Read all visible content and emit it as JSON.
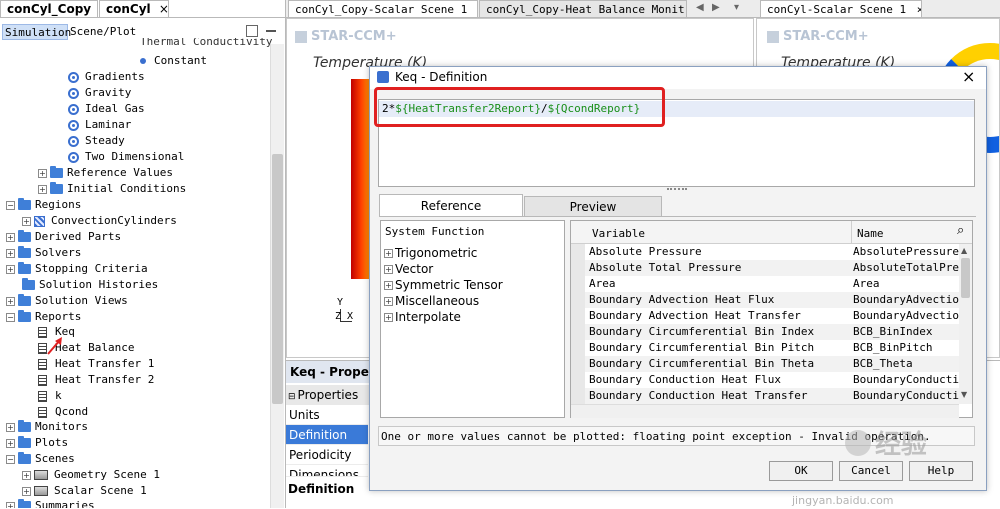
{
  "left_tabs": [
    {
      "label": "conCyl_Copy"
    },
    {
      "label": "conCyl",
      "close": "×"
    }
  ],
  "left_subtabs": [
    {
      "label": "Simulation"
    },
    {
      "label": "Scene/Plot"
    }
  ],
  "scene_tabs": [
    {
      "label": "conCyl_Copy-Scalar Scene 1",
      "close": "×"
    },
    {
      "label": "conCyl_Copy-Heat Balance Monit"
    },
    {
      "label": "conCyl-Scalar Scene 1",
      "close": "×"
    }
  ],
  "tree": {
    "partial_top": "Thermal Conductivity",
    "constant": "Constant",
    "models": [
      "Gradients",
      "Gravity",
      "Ideal Gas",
      "Laminar",
      "Steady",
      "Two Dimensional"
    ],
    "reference_values": "Reference Values",
    "initial_conditions": "Initial Conditions",
    "regions": "Regions",
    "region_child": "ConvectionCylinders",
    "derived_parts": "Derived Parts",
    "solvers": "Solvers",
    "stopping_criteria": "Stopping Criteria",
    "solution_histories": "Solution Histories",
    "solution_views": "Solution Views",
    "reports": "Reports",
    "report_items": [
      "Keq",
      "Heat Balance",
      "Heat Transfer 1",
      "Heat Transfer 2",
      "k",
      "Qcond"
    ],
    "monitors": "Monitors",
    "plots": "Plots",
    "scenes": "Scenes",
    "scene_items": [
      "Geometry Scene 1",
      "Scalar Scene 1"
    ],
    "summaries": "Summaries"
  },
  "scene_left": {
    "logo": "STAR-CCM+",
    "title": "Temperature (K)",
    "axis_y": "Y",
    "axis_z": "Z",
    "axis_x": "X"
  },
  "scene_right": {
    "logo": "STAR-CCM+",
    "title": "Temperature (K)"
  },
  "properties": {
    "header": "Keq - Properties",
    "section": "Properties",
    "rows": [
      "Units",
      "Definition",
      "Periodicity",
      "Dimensions"
    ],
    "footer_label": "Definition"
  },
  "dialog": {
    "title": "Keq - Definition",
    "close": "×",
    "expr_prefix": "2*",
    "expr_var1": "${HeatTransfer2Report}",
    "expr_slash": "/",
    "expr_var2": "${QcondReport}",
    "tabs": [
      "Reference",
      "Preview"
    ],
    "sf_header": "System Function",
    "sf_items": [
      "Trigonometric",
      "Vector",
      "Symmetric Tensor",
      "Miscellaneous",
      "Interpolate"
    ],
    "col_variable": "Variable",
    "col_name": "Name",
    "variables": [
      {
        "variable": "Absolute Pressure",
        "name": "AbsolutePressure"
      },
      {
        "variable": "Absolute Total Pressure",
        "name": "AbsoluteTotalPres"
      },
      {
        "variable": "Area",
        "name": "Area"
      },
      {
        "variable": "Boundary Advection Heat Flux",
        "name": "BoundaryAdvection"
      },
      {
        "variable": "Boundary Advection Heat Transfer",
        "name": "BoundaryAdvection"
      },
      {
        "variable": "Boundary Circumferential Bin Index",
        "name": "BCB_BinIndex"
      },
      {
        "variable": "Boundary Circumferential Bin Pitch",
        "name": "BCB_BinPitch"
      },
      {
        "variable": "Boundary Circumferential Bin Theta",
        "name": "BCB_Theta"
      },
      {
        "variable": "Boundary Conduction Heat Flux",
        "name": "BoundaryConductic"
      },
      {
        "variable": "Boundary Conduction Heat Transfer",
        "name": "BoundaryConductic"
      }
    ],
    "status": "One or more values cannot be plotted: floating point exception - Invalid operation.",
    "buttons": [
      "OK",
      "Cancel",
      "Help"
    ]
  },
  "watermark": {
    "text": "经验",
    "url": "jingyan.baidu.com"
  },
  "colors": {
    "accent": "#3a6fcf",
    "highlight_box": "#e02020",
    "selection": "#3a7ad8",
    "expr_var": "#1a8f1a"
  }
}
